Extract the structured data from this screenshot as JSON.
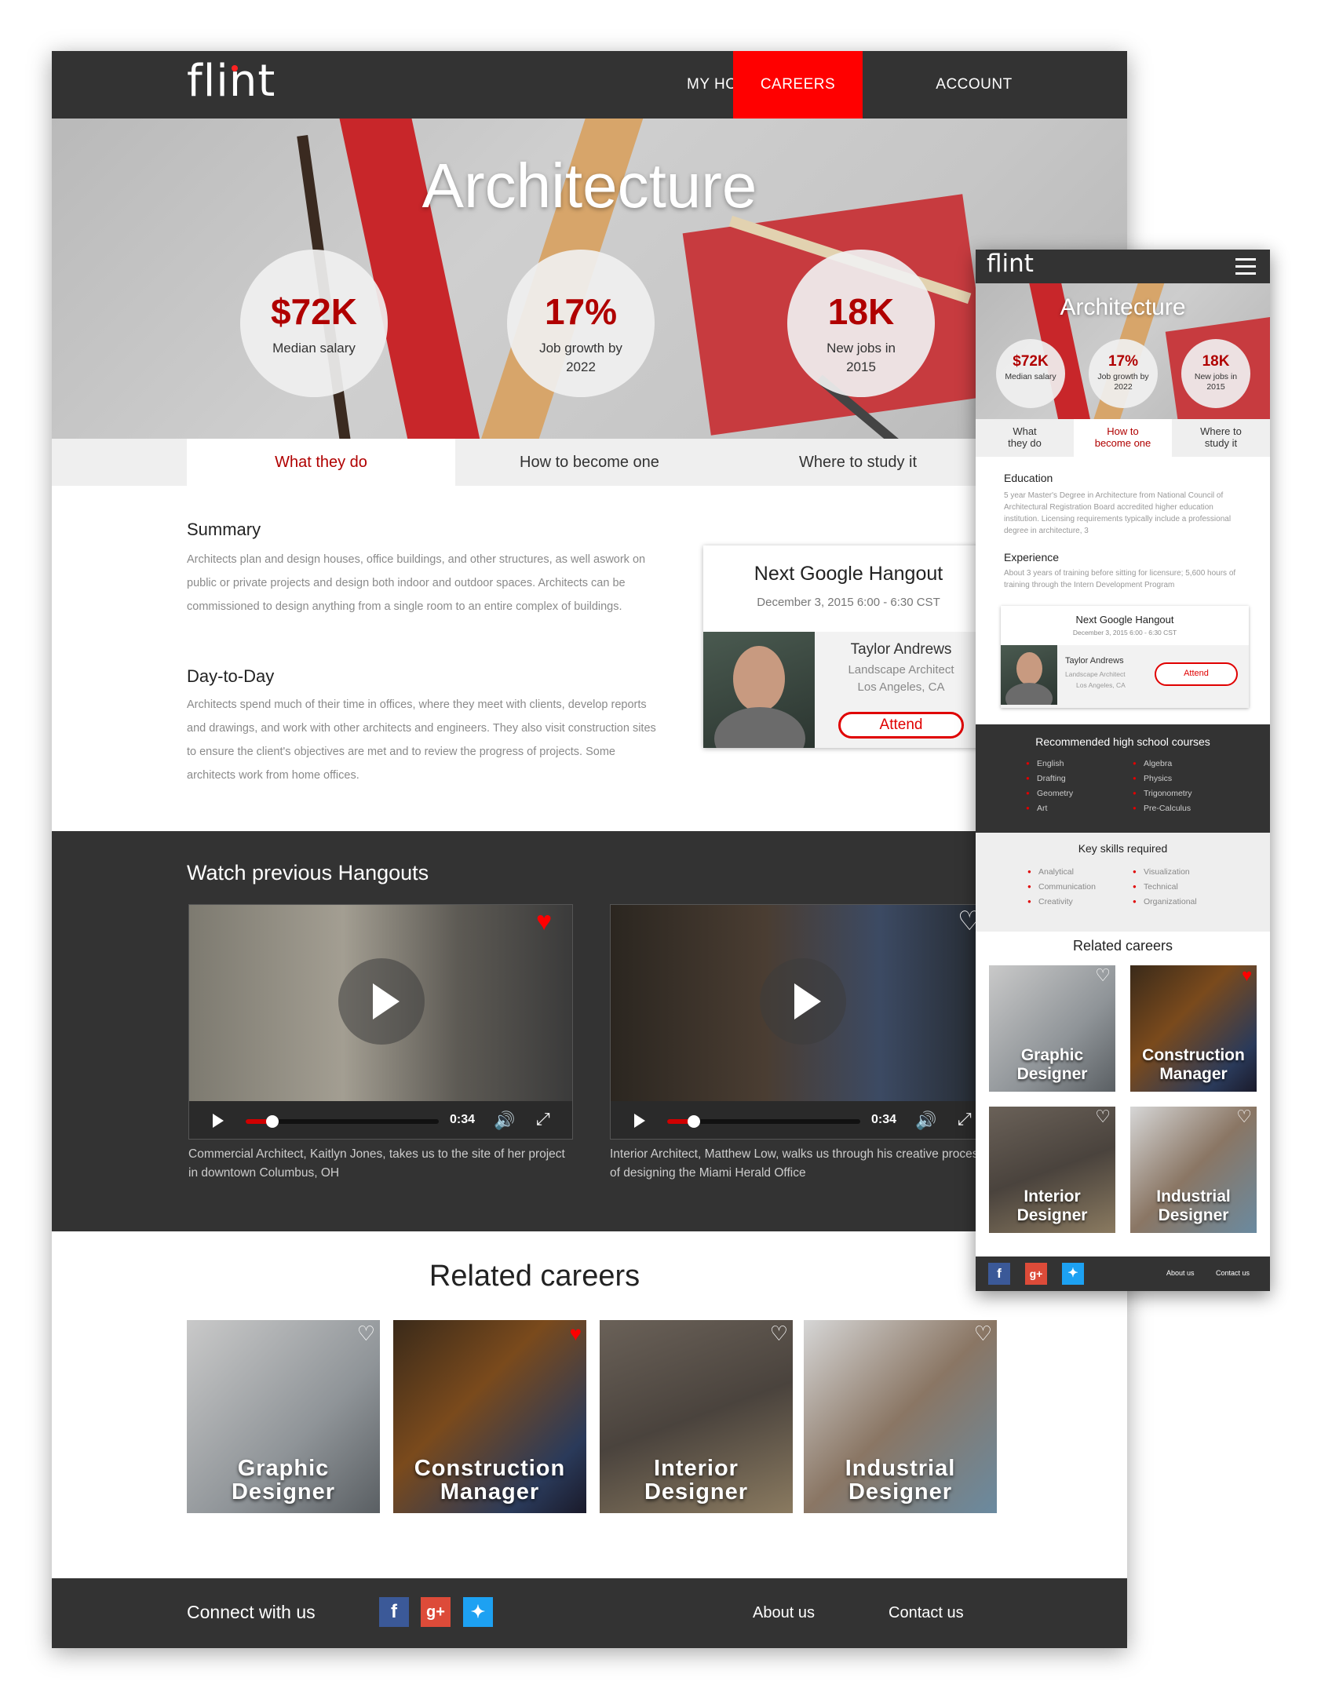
{
  "desktop": {
    "nav": {
      "logo": "flint",
      "items": [
        "MY HOME",
        "CAREERS",
        "ACCOUNT"
      ],
      "active": "CAREERS"
    },
    "hero": {
      "title": "Architecture",
      "stats": [
        {
          "value": "$72K",
          "label": "Median salary"
        },
        {
          "value": "17%",
          "label": "Job growth by 2022"
        },
        {
          "value": "18K",
          "label": "New jobs in 2015"
        }
      ]
    },
    "tabs": [
      "What they do",
      "How to become one",
      "Where to study it"
    ],
    "summary": {
      "heading": "Summary",
      "text": "Architects plan and design houses, office buildings, and other structures, as well aswork on public or private projects and design both indoor and outdoor spaces. Architects can be commissioned to design anything from a single room to an entire complex of buildings."
    },
    "daytoday": {
      "heading": "Day-to-Day",
      "text": "Architects spend much of their time in offices, where they meet with clients, develop reports and drawings, and work with other architects and engineers. They also visit construction sites to ensure the client's objectives are met and to review the progress of projects. Some architects work from home offices."
    },
    "hangout": {
      "title": "Next Google Hangout",
      "date": "December 3, 2015  6:00 - 6:30 CST",
      "person": "Taylor Andrews",
      "role": "Landscape Architect",
      "location": "Los Angeles, CA",
      "button": "Attend"
    },
    "previous": {
      "heading": "Watch previous Hangouts",
      "videos": [
        {
          "time": "0:34",
          "progress": 0.14,
          "favorited": true,
          "caption": "Commercial Architect, Kaitlyn Jones, takes us to the site of her project in downtown Columbus, OH"
        },
        {
          "time": "0:34",
          "progress": 0.14,
          "favorited": false,
          "caption": "Interior Architect, Matthew Low, walks us through his creative process of designing the Miami Herald Office"
        }
      ]
    },
    "related": {
      "heading": "Related careers",
      "cards": [
        {
          "line1": "Graphic",
          "line2": "Designer",
          "favorited": false
        },
        {
          "line1": "Construction",
          "line2": "Manager",
          "favorited": true
        },
        {
          "line1": "Interior",
          "line2": "Designer",
          "favorited": false
        },
        {
          "line1": "Industrial",
          "line2": "Designer",
          "favorited": false
        }
      ]
    },
    "footer": {
      "connect": "Connect with us",
      "social": [
        "f",
        "g+",
        "twitter"
      ],
      "links": [
        "About us",
        "Contact us"
      ]
    }
  },
  "mobile": {
    "logo": "flint",
    "title": "Architecture",
    "stats": [
      {
        "value": "$72K",
        "label": "Median salary"
      },
      {
        "value": "17%",
        "label": "Job growth by 2022"
      },
      {
        "value": "18K",
        "label": "New jobs in 2015"
      }
    ],
    "tabs": [
      {
        "line1": "What",
        "line2": "they do"
      },
      {
        "line1": "How to",
        "line2": "become one"
      },
      {
        "line1": "Where to",
        "line2": "study it"
      }
    ],
    "education": {
      "heading": "Education",
      "text": "5 year Master's Degree in Architecture from National Council of Architectural Registration Board accredited higher education institution. Licensing requirements typically include a professional degree in architecture, 3"
    },
    "experience": {
      "heading": "Experience",
      "text": "About 3 years of training before sitting for licensure; 5,600 hours of training through the Intern Development Program"
    },
    "hangout": {
      "title": "Next Google Hangout",
      "date": "December 3, 2015  6:00 - 6:30 CST",
      "person": "Taylor Andrews",
      "role": "Landscape Architect",
      "location": "Los Angeles, CA",
      "button": "Attend"
    },
    "courses": {
      "heading": "Recommended high school courses",
      "left": [
        "English",
        "Drafting",
        "Geometry",
        "Art"
      ],
      "right": [
        "Algebra",
        "Physics",
        "Trigonometry",
        "Pre-Calculus"
      ]
    },
    "skills": {
      "heading": "Key skills required",
      "left": [
        "Analytical",
        "Communication",
        "Creativity"
      ],
      "right": [
        "Visualization",
        "Technical",
        "Organizational"
      ]
    },
    "related": {
      "heading": "Related careers",
      "cards": [
        {
          "line1": "Graphic",
          "line2": "Designer",
          "favorited": false
        },
        {
          "line1": "Construction",
          "line2": "Manager",
          "favorited": true
        },
        {
          "line1": "Interior",
          "line2": "Designer",
          "favorited": false
        },
        {
          "line1": "Industrial",
          "line2": "Designer",
          "favorited": false
        }
      ]
    },
    "footer": {
      "links": [
        "About us",
        "Contact us"
      ]
    }
  },
  "colors": {
    "accent": "#ff0000",
    "dark": "#333333",
    "stat": "#b00000"
  }
}
